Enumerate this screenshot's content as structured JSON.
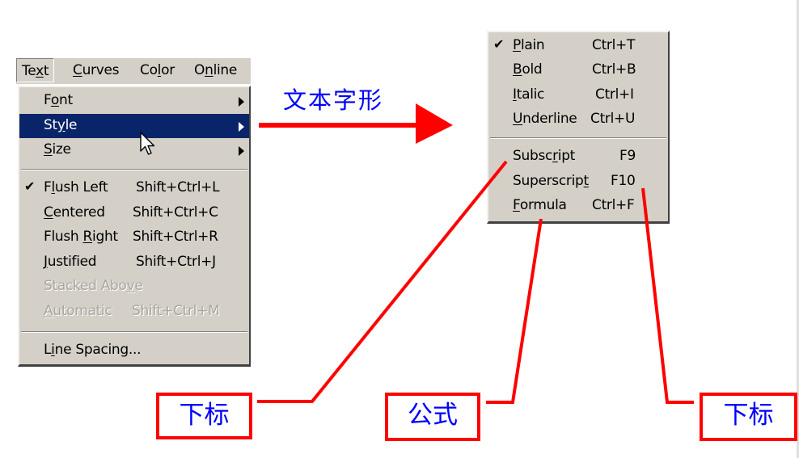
{
  "menubar": {
    "items": [
      {
        "label": "Text",
        "mnemonic_index": 2,
        "active": true
      },
      {
        "label": "Curves",
        "mnemonic_index": 0
      },
      {
        "label": "Color",
        "mnemonic_index": 2
      },
      {
        "label": "Online",
        "mnemonic_index": 1
      }
    ]
  },
  "text_menu": {
    "items": [
      {
        "label": "Font",
        "submenu": true
      },
      {
        "label": "Style",
        "submenu": true,
        "highlighted": true
      },
      {
        "label": "Size",
        "submenu": true
      },
      {
        "label": "Flush Left",
        "shortcut": "Shift+Ctrl+L",
        "checked": true
      },
      {
        "label": "Centered",
        "shortcut": "Shift+Ctrl+C"
      },
      {
        "label": "Flush Right",
        "shortcut": "Shift+Ctrl+R"
      },
      {
        "label": "Justified",
        "shortcut": "Shift+Ctrl+J"
      },
      {
        "label": "Stacked Above",
        "disabled": true
      },
      {
        "label": "Automatic",
        "shortcut": "Shift+Ctrl+M",
        "disabled": true
      },
      {
        "label": "Line Spacing..."
      }
    ]
  },
  "style_menu": {
    "items": [
      {
        "label": "Plain",
        "shortcut": "Ctrl+T",
        "checked": true
      },
      {
        "label": "Bold",
        "shortcut": "Ctrl+B"
      },
      {
        "label": "Italic",
        "shortcut": "Ctrl+I"
      },
      {
        "label": "Underline",
        "shortcut": "Ctrl+U"
      },
      {
        "label": "Subscript",
        "shortcut": "F9"
      },
      {
        "label": "Superscript",
        "shortcut": "F10"
      },
      {
        "label": "Formula",
        "shortcut": "Ctrl+F"
      }
    ]
  },
  "icons": {
    "check": "✔",
    "submenu_arrow": "triangle-right",
    "cursor": "arrow-pointer"
  },
  "annotations": {
    "arrow_label": "文本字形",
    "callouts": [
      {
        "text": "下标",
        "points_to": "Subscript"
      },
      {
        "text": "公式",
        "points_to": "Formula"
      },
      {
        "text": "下标",
        "points_to": "Superscript"
      }
    ],
    "colors": {
      "line": "#ff0000",
      "text": "#0000ff",
      "highlight": "#0a246a",
      "menu_bg": "#d4d0c8"
    }
  }
}
